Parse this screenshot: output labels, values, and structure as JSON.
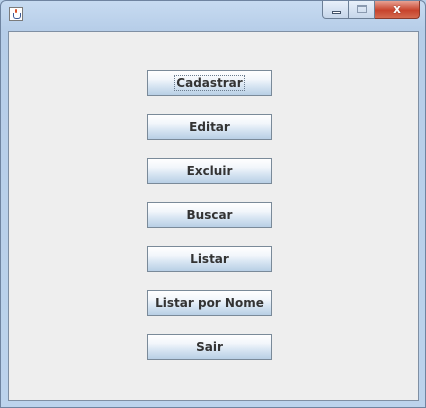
{
  "window": {
    "title": "",
    "close_glyph": "x",
    "accent": "#b9d1ea",
    "close_color": "#c7432c"
  },
  "icons": {
    "app": "java-cup-icon",
    "minimize": "minimize-icon",
    "maximize": "maximize-icon",
    "close": "close-icon"
  },
  "menu": {
    "buttons": [
      {
        "label": "Cadastrar",
        "focused": true
      },
      {
        "label": "Editar"
      },
      {
        "label": "Excluir"
      },
      {
        "label": "Buscar"
      },
      {
        "label": "Listar"
      },
      {
        "label": "Listar por Nome"
      },
      {
        "label": "Sair"
      }
    ]
  }
}
